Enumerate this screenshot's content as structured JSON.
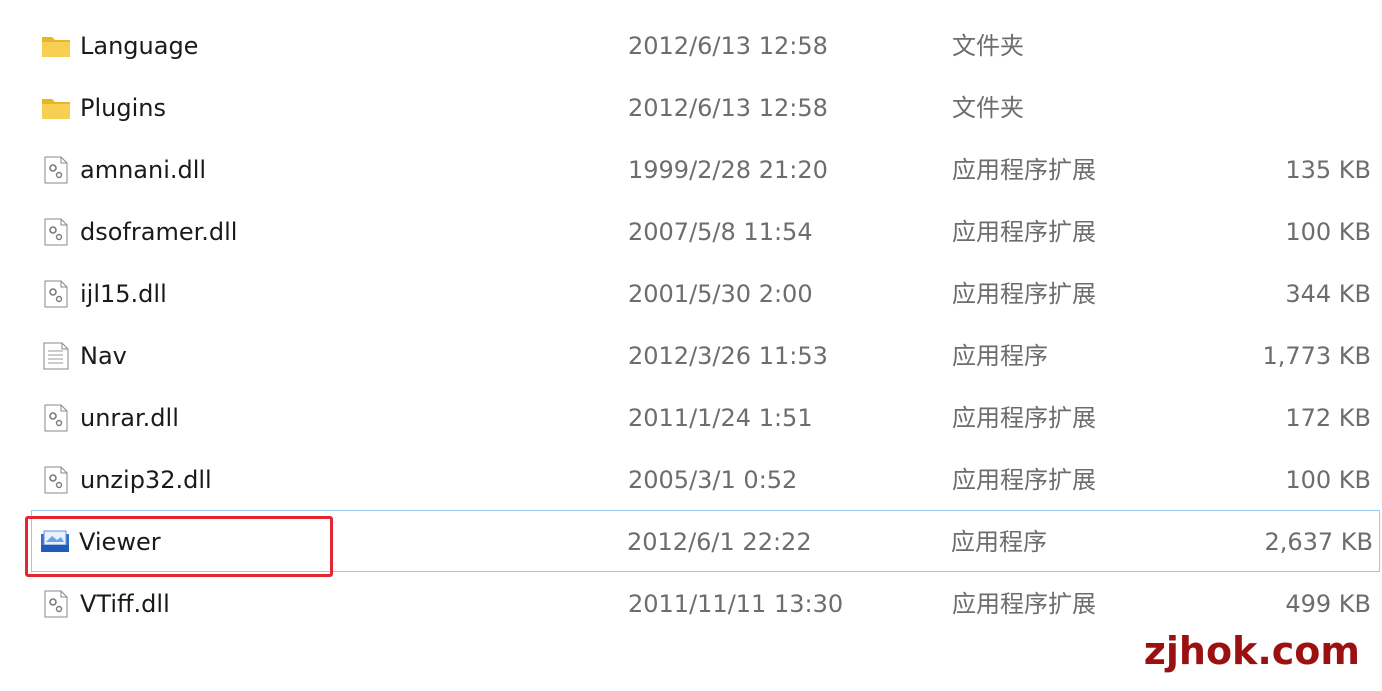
{
  "files": [
    {
      "icon": "folder-icon",
      "name": "Language",
      "date": "2012/6/13 12:58",
      "type": "文件夹",
      "size": ""
    },
    {
      "icon": "folder-icon",
      "name": "Plugins",
      "date": "2012/6/13 12:58",
      "type": "文件夹",
      "size": ""
    },
    {
      "icon": "dll-file-icon",
      "name": "amnani.dll",
      "date": "1999/2/28 21:20",
      "type": "应用程序扩展",
      "size": "135 KB"
    },
    {
      "icon": "dll-file-icon",
      "name": "dsoframer.dll",
      "date": "2007/5/8 11:54",
      "type": "应用程序扩展",
      "size": "100 KB"
    },
    {
      "icon": "dll-file-icon",
      "name": "ijl15.dll",
      "date": "2001/5/30 2:00",
      "type": "应用程序扩展",
      "size": "344 KB"
    },
    {
      "icon": "text-document-icon",
      "name": "Nav",
      "date": "2012/3/26 11:53",
      "type": "应用程序",
      "size": "1,773 KB"
    },
    {
      "icon": "dll-file-icon",
      "name": "unrar.dll",
      "date": "2011/1/24 1:51",
      "type": "应用程序扩展",
      "size": "172 KB"
    },
    {
      "icon": "dll-file-icon",
      "name": "unzip32.dll",
      "date": "2005/3/1 0:52",
      "type": "应用程序扩展",
      "size": "100 KB"
    },
    {
      "icon": "viewer-app-icon",
      "name": "Viewer",
      "date": "2012/6/1 22:22",
      "type": "应用程序",
      "size": "2,637 KB",
      "selected": true
    },
    {
      "icon": "dll-file-icon",
      "name": "VTiff.dll",
      "date": "2011/11/11 13:30",
      "type": "应用程序扩展",
      "size": "499 KB"
    }
  ],
  "watermark": "zjhok.com",
  "colors": {
    "highlight_border": "#e3262f",
    "selection_border": "#99c9ef",
    "folder": "#f3c545",
    "watermark": "#9b1111"
  }
}
